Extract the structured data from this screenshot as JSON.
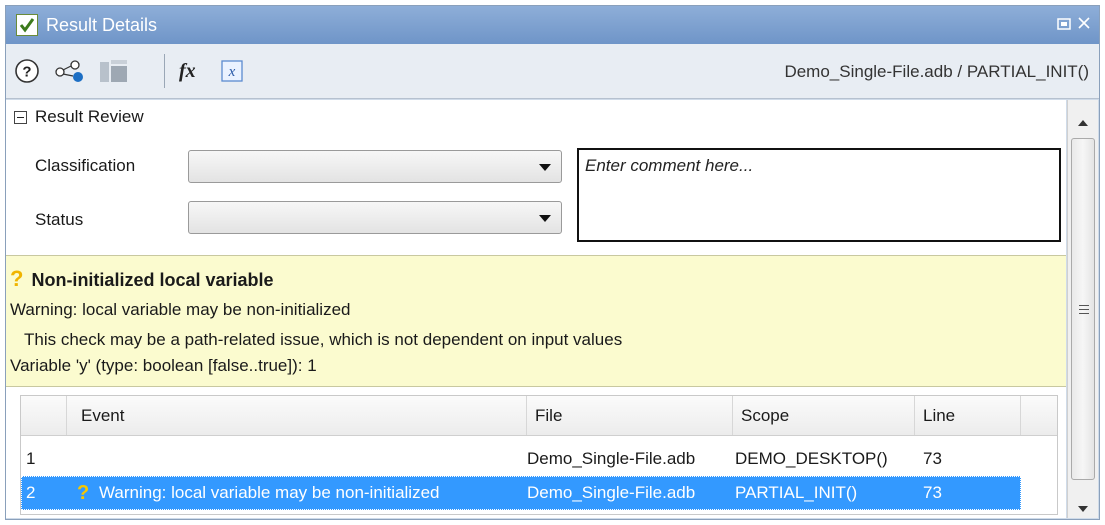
{
  "window": {
    "title": "Result Details",
    "controls": [
      "restore-icon",
      "close-icon"
    ]
  },
  "toolbar": {
    "icons": [
      "help-icon",
      "share-icon",
      "layers-icon",
      "function-fx-icon",
      "variable-x-icon"
    ],
    "breadcrumb": "Demo_Single-File.adb / PARTIAL_INIT()"
  },
  "review": {
    "section_label": "Result Review",
    "classification_label": "Classification",
    "classification_value": "",
    "status_label": "Status",
    "status_value": "",
    "comment_placeholder": "Enter comment here..."
  },
  "warning": {
    "title": "Non-initialized local variable",
    "line1": "Warning: local variable may be non-initialized",
    "line2": "This check may be a path-related issue, which is not dependent on input values",
    "line3": "Variable 'y' (type: boolean [false..true]): 1"
  },
  "events": {
    "columns": [
      "Event",
      "File",
      "Scope",
      "Line"
    ],
    "rows": [
      {
        "num": "1",
        "event": "",
        "file": "Demo_Single-File.adb",
        "scope": "DEMO_DESKTOP()",
        "line": "73"
      },
      {
        "num": "2",
        "event": "Warning: local variable may be non-initialized",
        "file": "Demo_Single-File.adb",
        "scope": "PARTIAL_INIT()",
        "line": "73",
        "selected": true
      }
    ]
  },
  "colors": {
    "titlebar": "#7fa2d0",
    "warning_bg": "#fbfbcf",
    "selection": "#3399ff",
    "question_mark": "#f0b400"
  }
}
